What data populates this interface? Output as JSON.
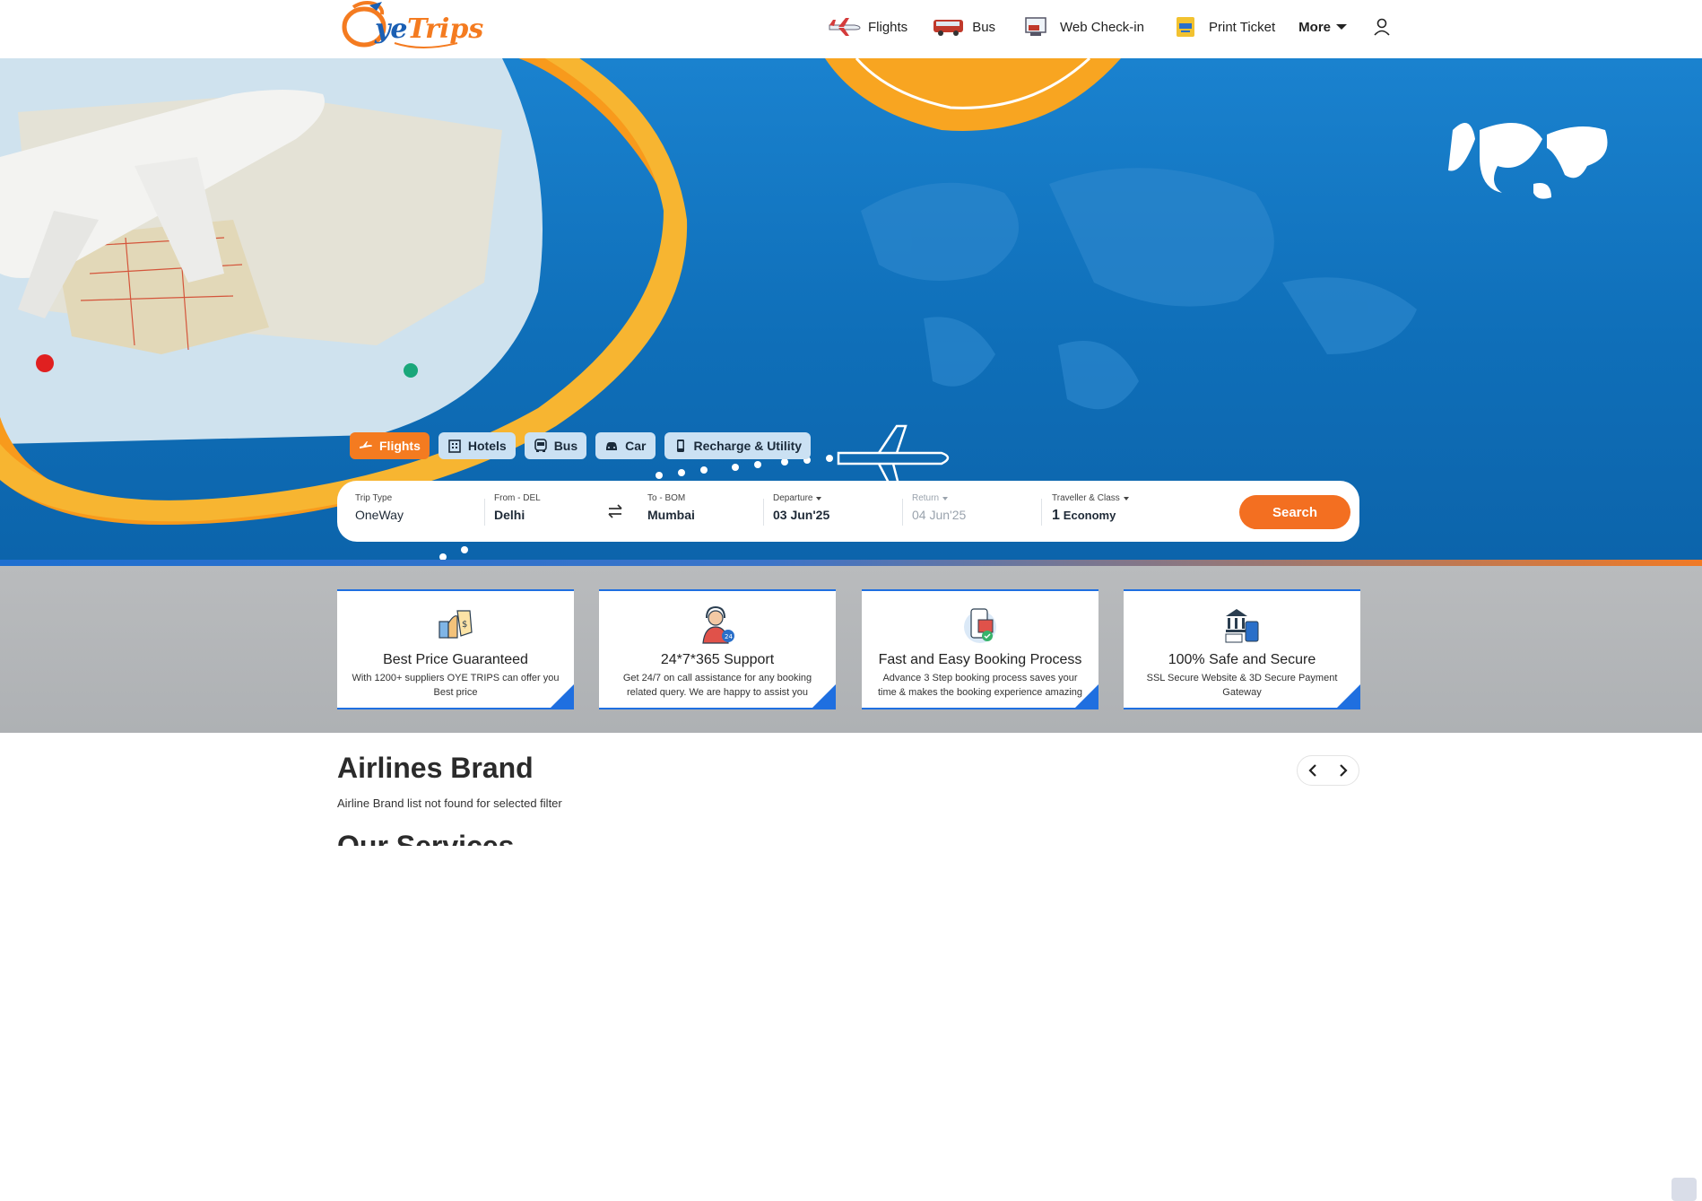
{
  "brand": {
    "name": "OyeTrips",
    "orange": "#f47b20",
    "blue": "#1b5fb3"
  },
  "nav": {
    "items": [
      {
        "label": "Flights",
        "icon": "airplane-icon"
      },
      {
        "label": "Bus",
        "icon": "bus-icon"
      },
      {
        "label": "Web Check-in",
        "icon": "web-checkin-icon"
      },
      {
        "label": "Print Ticket",
        "icon": "print-ticket-icon"
      }
    ],
    "more_label": "More",
    "user_icon": "user-icon"
  },
  "tabs": [
    {
      "label": "Flights",
      "icon": "airplane-icon",
      "active": true
    },
    {
      "label": "Hotels",
      "icon": "building-icon",
      "active": false
    },
    {
      "label": "Bus",
      "icon": "bus-icon",
      "active": false
    },
    {
      "label": "Car",
      "icon": "car-icon",
      "active": false
    },
    {
      "label": "Recharge & Utility",
      "icon": "mobile-icon",
      "active": false
    }
  ],
  "search": {
    "trip_type": {
      "label": "Trip Type",
      "value": "OneWay"
    },
    "from": {
      "label": "From - DEL",
      "value": "Delhi"
    },
    "to": {
      "label": "To - BOM",
      "value": "Mumbai"
    },
    "departure": {
      "label": "Departure",
      "value": "03 Jun'25"
    },
    "return": {
      "label": "Return",
      "value": "04 Jun'25"
    },
    "traveller": {
      "label": "Traveller & Class",
      "count": "1",
      "class": "Economy"
    },
    "button_label": "Search"
  },
  "features": [
    {
      "title": "Best Price Guaranteed",
      "desc": "With 1200+ suppliers OYE TRIPS can offer you Best price",
      "icon": "price-tag-icon"
    },
    {
      "title": "24*7*365 Support",
      "desc": "Get 24/7 on call assistance for any booking related query. We are happy to assist you",
      "icon": "support-agent-icon"
    },
    {
      "title": "Fast and Easy Booking Process",
      "desc": "Advance 3 Step booking process saves your time & makes the booking experience amazing",
      "icon": "booking-icon"
    },
    {
      "title": "100% Safe and Secure",
      "desc": "SSL Secure Website & 3D Secure Payment Gateway",
      "icon": "secure-bank-icon"
    }
  ],
  "airlines": {
    "title": "Airlines Brand",
    "message": "Airline Brand list not found for selected filter"
  },
  "next_section": {
    "title": "Our Services"
  }
}
